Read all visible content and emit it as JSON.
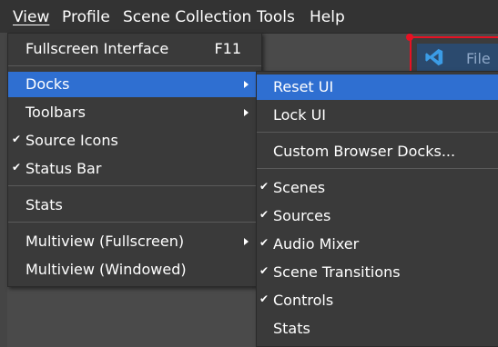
{
  "menubar": {
    "items": [
      {
        "label": "View",
        "active": true
      },
      {
        "label": "Profile"
      },
      {
        "label": "Scene Collection"
      },
      {
        "label": "Tools"
      },
      {
        "label": "Help"
      }
    ]
  },
  "background_window": {
    "label": "File",
    "icon": "vscode-icon",
    "accent_color": "#e81123"
  },
  "view_menu": {
    "fullscreen_label": "Fullscreen Interface",
    "fullscreen_shortcut": "F11",
    "docks_label": "Docks",
    "toolbars_label": "Toolbars",
    "source_icons_label": "Source Icons",
    "source_icons_checked": true,
    "status_bar_label": "Status Bar",
    "status_bar_checked": true,
    "stats_label": "Stats",
    "multiview_fullscreen_label": "Multiview (Fullscreen)",
    "multiview_windowed_label": "Multiview (Windowed)"
  },
  "docks_submenu": {
    "reset_ui_label": "Reset UI",
    "lock_ui_label": "Lock UI",
    "custom_browser_docks_label": "Custom Browser Docks...",
    "scenes_label": "Scenes",
    "sources_label": "Sources",
    "audio_mixer_label": "Audio Mixer",
    "scene_transitions_label": "Scene Transitions",
    "controls_label": "Controls",
    "stats_label": "Stats",
    "check_glyph": "✔",
    "highlight_color": "#2f6fd1"
  }
}
